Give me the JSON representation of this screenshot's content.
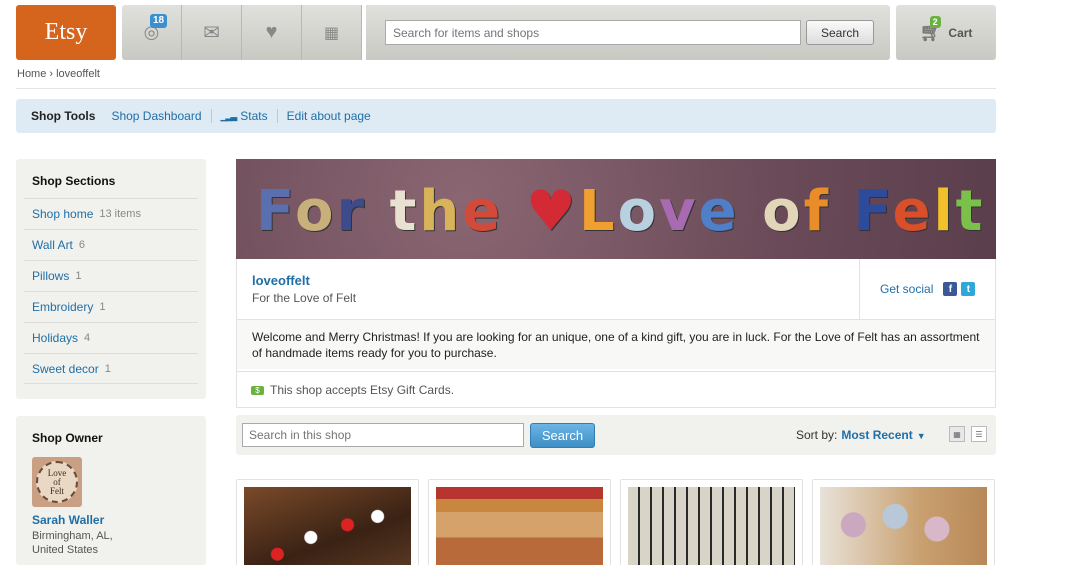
{
  "header": {
    "logo": "Etsy",
    "activity_badge": "18",
    "search_placeholder": "Search for items and shops",
    "search_button": "Search",
    "cart_label": "Cart",
    "cart_badge": "2"
  },
  "breadcrumb": "Home › loveoffelt",
  "shop_tools": {
    "title": "Shop Tools",
    "dashboard": "Shop Dashboard",
    "stats": "Stats",
    "edit_about": "Edit about page"
  },
  "sections": {
    "title": "Shop Sections",
    "items": [
      {
        "label": "Shop home",
        "count": "13 items"
      },
      {
        "label": "Wall Art",
        "count": "6"
      },
      {
        "label": "Pillows",
        "count": "1"
      },
      {
        "label": "Embroidery",
        "count": "1"
      },
      {
        "label": "Holidays",
        "count": "4"
      },
      {
        "label": "Sweet decor",
        "count": "1"
      }
    ]
  },
  "owner": {
    "title": "Shop Owner",
    "name": "Sarah Waller",
    "location_line1": "Birmingham, AL,",
    "location_line2": "United States"
  },
  "banner": {
    "text": "For the Love of Felt"
  },
  "shop": {
    "name": "loveoffelt",
    "title": "For the Love of Felt",
    "get_social": "Get social",
    "welcome": "Welcome and Merry Christmas! If you are looking for an unique, one of a kind gift, you are in luck. For the Love of Felt has an assortment of handmade items ready for you to purchase.",
    "gift_cards": "This shop accepts Etsy Gift Cards."
  },
  "shop_search": {
    "placeholder": "Search in this shop",
    "button": "Search",
    "sort_label": "Sort by:",
    "sort_value": "Most Recent"
  },
  "icons": [
    "activity-icon",
    "mail-icon",
    "heart-icon",
    "shop-icon",
    "cart-icon",
    "stats-icon",
    "facebook-icon",
    "twitter-icon",
    "gift-card-icon",
    "grid-view-icon",
    "list-view-icon"
  ],
  "colors": {
    "brand": "#d5641c",
    "link": "#1f6fa7",
    "tools_bg": "#deeaf4",
    "search_btn": "#3d8fc6",
    "badge": "#3a8fcf",
    "cart_badge": "#6bb142"
  }
}
